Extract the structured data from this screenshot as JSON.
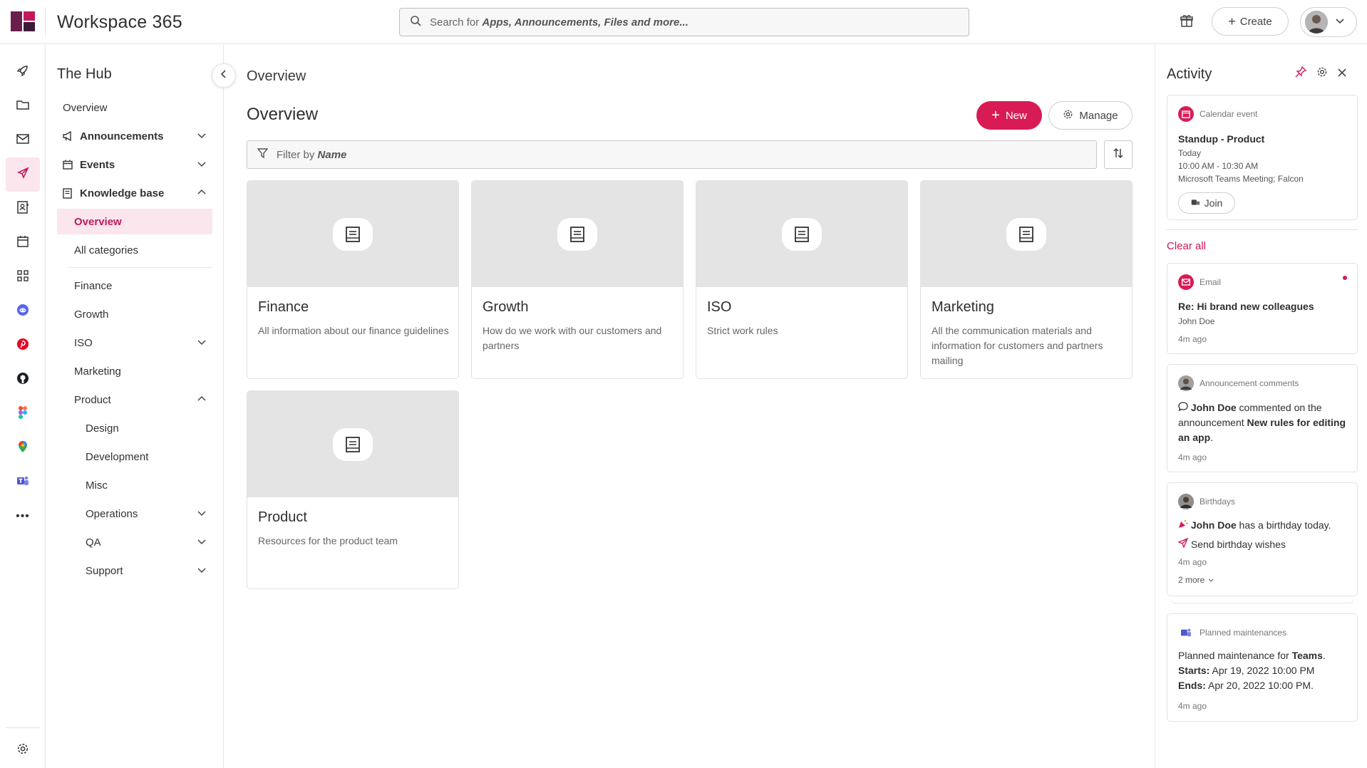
{
  "header": {
    "app_name": "Workspace 365",
    "search_placeholder_prefix": "Search for ",
    "search_placeholder_emph": "Apps, Announcements, Files and more...",
    "create_label": "Create",
    "brand_color": "#d81b55",
    "logo_colors": [
      "#6b1d4c",
      "#c2185b",
      "#3d1a3a"
    ]
  },
  "rail": {
    "icons": [
      "rocket-icon",
      "folder-icon",
      "mail-icon",
      "megaphone-icon",
      "contacts-icon",
      "calendar-icon",
      "apps-grid-icon",
      "discord-icon",
      "pinterest-icon",
      "github-icon",
      "figma-icon",
      "maps-icon",
      "teams-icon",
      "more-icon",
      "settings-icon"
    ]
  },
  "hub": {
    "title": "The Hub",
    "items": [
      {
        "label": "Overview"
      },
      {
        "label": "Announcements"
      },
      {
        "label": "Events"
      },
      {
        "label": "Knowledge base"
      },
      {
        "label": "Overview"
      },
      {
        "label": "All categories"
      },
      {
        "label": "Finance"
      },
      {
        "label": "Growth"
      },
      {
        "label": "ISO"
      },
      {
        "label": "Marketing"
      },
      {
        "label": "Product"
      },
      {
        "label": "Design"
      },
      {
        "label": "Development"
      },
      {
        "label": "Misc"
      },
      {
        "label": "Operations"
      },
      {
        "label": "QA"
      },
      {
        "label": "Support"
      }
    ]
  },
  "main": {
    "breadcrumb": "Overview",
    "title": "Overview",
    "new_label": "New",
    "manage_label": "Manage",
    "filter_prefix": "Filter by ",
    "filter_field": "Name",
    "cards": [
      {
        "title": "Finance",
        "desc": "All information about our finance guidelines"
      },
      {
        "title": "Growth",
        "desc": "How do we work with our customers and partners"
      },
      {
        "title": "ISO",
        "desc": "Strict work rules"
      },
      {
        "title": "Marketing",
        "desc": "All the communication materials and information for customers and partners mailing"
      },
      {
        "title": "Product",
        "desc": "Resources for the product team"
      }
    ]
  },
  "activity": {
    "title": "Activity",
    "clear_all": "Clear all",
    "calendar": {
      "source": "Calendar event",
      "title": "Standup - Product",
      "day": "Today",
      "time": "10:00 AM - 10:30 AM",
      "location": "Microsoft Teams Meeting; Falcon",
      "join": "Join"
    },
    "email": {
      "source": "Email",
      "title": "Re: Hi brand new colleagues",
      "from": "John Doe",
      "time": "4m ago"
    },
    "comment": {
      "source": "Announcement comments",
      "name": "John Doe",
      "text1": " commented on the announcement ",
      "target": "New rules for editing an app",
      "end": ".",
      "time": "4m ago"
    },
    "birthday": {
      "source": "Birthdays",
      "name": "John Doe",
      "text": " has a birthday today.",
      "action": "Send birthday wishes",
      "time": "4m ago",
      "more": "2 more"
    },
    "maintenance": {
      "source": "Planned maintenances",
      "line1_pre": "Planned maintenance for ",
      "line1_app": "Teams",
      "line1_end": ".",
      "starts_label": "Starts:",
      "starts": " Apr 19, 2022 10:00 PM",
      "ends_label": "Ends:",
      "ends": " Apr 20, 2022 10:00 PM.",
      "time": "4m ago"
    }
  }
}
